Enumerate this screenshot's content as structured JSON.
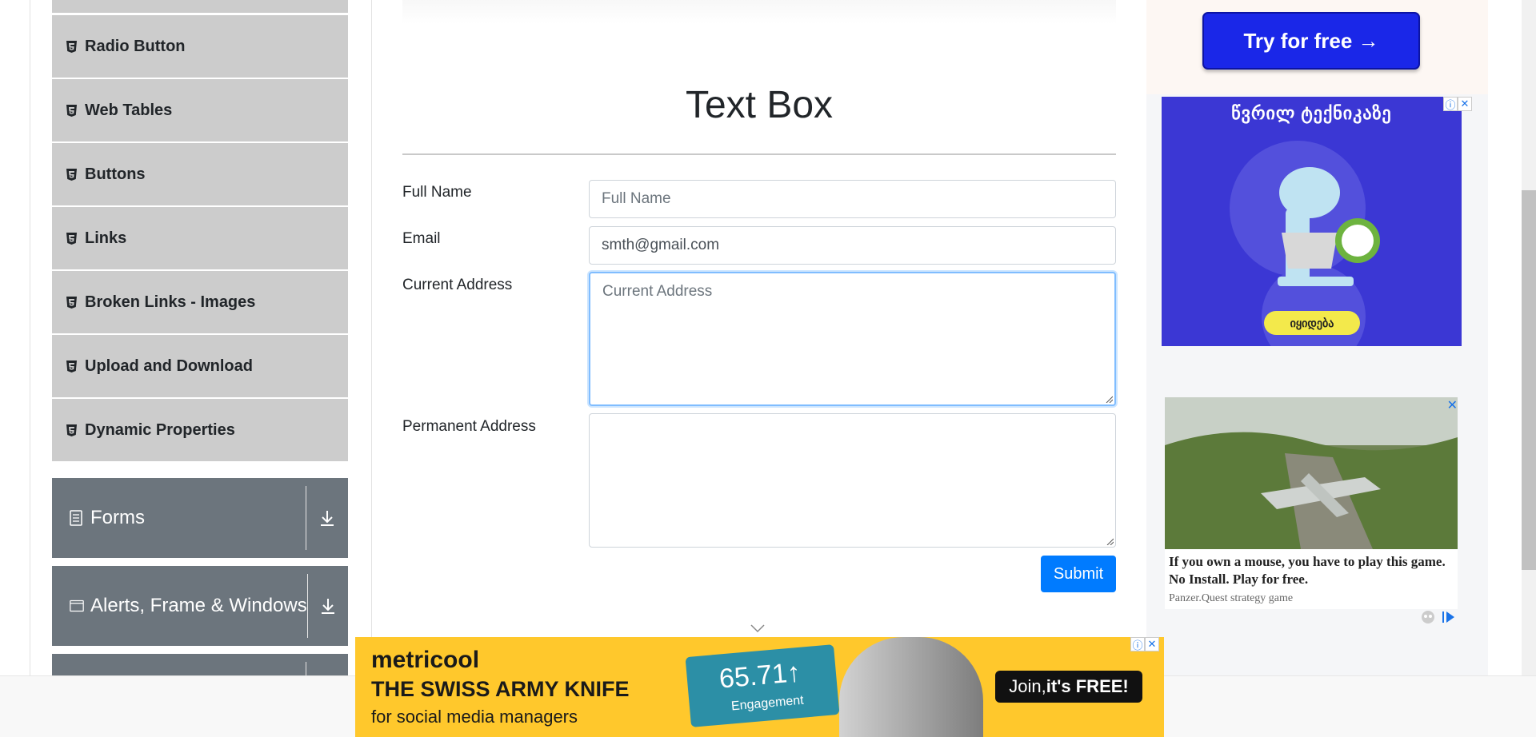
{
  "sidebar": {
    "elements_items": [
      {
        "label": "Radio Button"
      },
      {
        "label": "Web Tables"
      },
      {
        "label": "Buttons"
      },
      {
        "label": "Links"
      },
      {
        "label": "Broken Links - Images"
      },
      {
        "label": "Upload and Download"
      },
      {
        "label": "Dynamic Properties"
      }
    ],
    "groups": [
      {
        "label": "Forms",
        "icon": "form-icon"
      },
      {
        "label": "Alerts, Frame & Windows",
        "icon": "window-icon"
      }
    ]
  },
  "main": {
    "title": "Text Box",
    "fields": {
      "full_name": {
        "label": "Full Name",
        "placeholder": "Full Name",
        "value": ""
      },
      "email": {
        "label": "Email",
        "value": "smth@gmail.com"
      },
      "current_address": {
        "label": "Current Address",
        "placeholder": "Current Address",
        "value": ""
      },
      "permanent_address": {
        "label": "Permanent Address",
        "value": ""
      }
    },
    "submit_label": "Submit"
  },
  "ads": {
    "top_button": "Try for free →",
    "geo_title": "წვრილ ტექნიკაზე",
    "geo_button": "იყიდება",
    "video_text": "If you own a mouse, you have to play this game. No Install. Play for free.",
    "video_source": "Panzer.Quest strategy game",
    "bottom": {
      "brand": "metricool",
      "headline": "THE SWISS ARMY KNIFE",
      "subline": "for social media managers",
      "metric_value": "65.71↑",
      "metric_label": "Engagement",
      "join_prefix": "Join, ",
      "join_bold": "it's FREE!"
    },
    "ad_mark_info": "ⓘ",
    "ad_mark_close": "✕"
  },
  "colors": {
    "sidebar_item_bg": "#cccccc",
    "group_header_bg": "#6c757d",
    "submit_bg": "#007bff",
    "focus_border": "#80bdff"
  }
}
